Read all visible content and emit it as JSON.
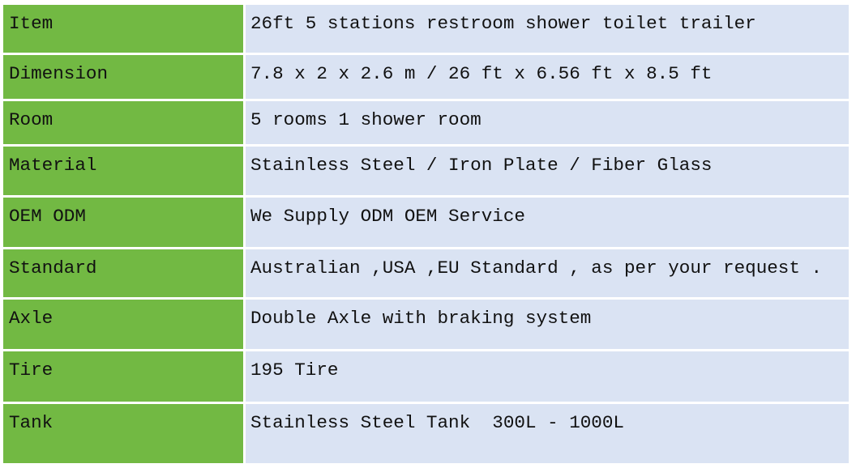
{
  "table": {
    "rows": [
      {
        "label": "Item",
        "value": "26ft 5 stations restroom shower toilet trailer"
      },
      {
        "label": "Dimension",
        "value": "7.8 x 2 x 2.6 m / 26 ft x 6.56 ft x 8.5 ft"
      },
      {
        "label": "Room",
        "value": "5 rooms 1 shower room"
      },
      {
        "label": "Material",
        "value": "Stainless Steel / Iron Plate / Fiber Glass"
      },
      {
        "label": "OEM ODM",
        "value": "We Supply ODM OEM Service"
      },
      {
        "label": "Standard",
        "value": "Australian ,USA ,EU Standard , as per your request ."
      },
      {
        "label": "Axle",
        "value": "Double Axle with braking system"
      },
      {
        "label": "Tire",
        "value": "195 Tire"
      },
      {
        "label": "Tank",
        "value": "Stainless Steel Tank  300L - 1000L"
      }
    ]
  },
  "colors": {
    "label_bg": "#72b943",
    "value_bg": "#dae3f3"
  }
}
